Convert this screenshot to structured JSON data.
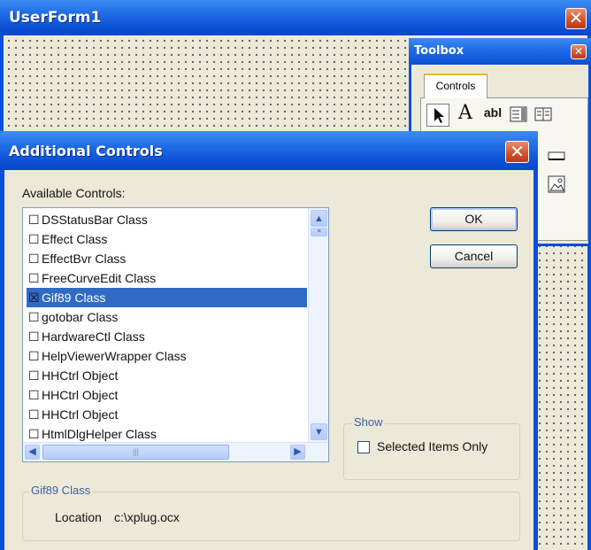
{
  "userform": {
    "title": "UserForm1",
    "close": "✕"
  },
  "toolbox": {
    "title": "Toolbox",
    "close": "✕",
    "tab": "Controls",
    "tools": [
      "select-arrow-icon",
      "label-icon",
      "textbox-icon",
      "combobox-icon",
      "listbox-icon"
    ]
  },
  "dialog": {
    "title": "Additional Controls",
    "close": "✕",
    "available_label": "Available Controls:",
    "items": [
      {
        "label": "DSStatusBar Class",
        "checked": false
      },
      {
        "label": "Effect Class",
        "checked": false
      },
      {
        "label": "EffectBvr Class",
        "checked": false
      },
      {
        "label": "FreeCurveEdit Class",
        "checked": false
      },
      {
        "label": "Gif89 Class",
        "checked": true,
        "selected": true
      },
      {
        "label": "gotobar Class",
        "checked": false
      },
      {
        "label": "HardwareCtl Class",
        "checked": false
      },
      {
        "label": "HelpViewerWrapper Class",
        "checked": false
      },
      {
        "label": "HHCtrl Object",
        "checked": false
      },
      {
        "label": "HHCtrl Object",
        "checked": false
      },
      {
        "label": "HHCtrl Object",
        "checked": false
      },
      {
        "label": "HtmlDlgHelper Class",
        "checked": false
      }
    ],
    "ok_label": "OK",
    "cancel_label": "Cancel",
    "show_group": "Show",
    "selected_only_label": "Selected Items Only",
    "info_group": "Gif89 Class",
    "location_label": "Location",
    "location_value": "c:\\xplug.ocx"
  },
  "colors": {
    "title_blue": "#0a4fd8",
    "selection": "#316ac5",
    "close_red": "#d0502c",
    "face": "#ece9d8"
  }
}
